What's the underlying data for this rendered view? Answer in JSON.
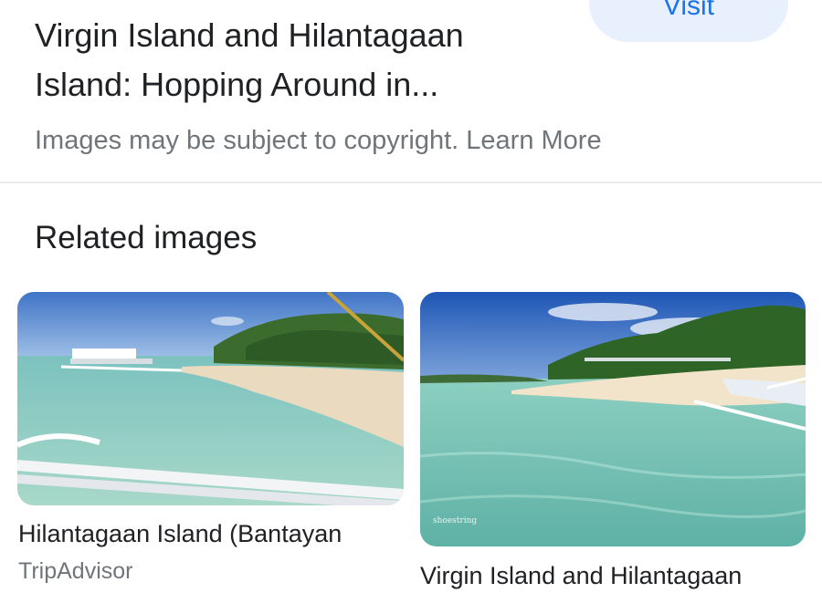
{
  "header": {
    "visit_label": "Visit",
    "title": "Virgin Island and Hilantagaan Island: Hopping Around in...",
    "copyright_text": "Images may be subject to copyright.",
    "learn_more": "Learn More"
  },
  "related": {
    "heading": "Related images",
    "items": [
      {
        "title": "Hilantagaan Island (Bantayan",
        "source": "TripAdvisor"
      },
      {
        "title": "Virgin Island and Hilantagaan",
        "watermark": "shoestring"
      }
    ]
  },
  "colors": {
    "accent": "#1a73e8",
    "pill_bg": "#e8f0fe",
    "muted_text": "#70757a"
  }
}
